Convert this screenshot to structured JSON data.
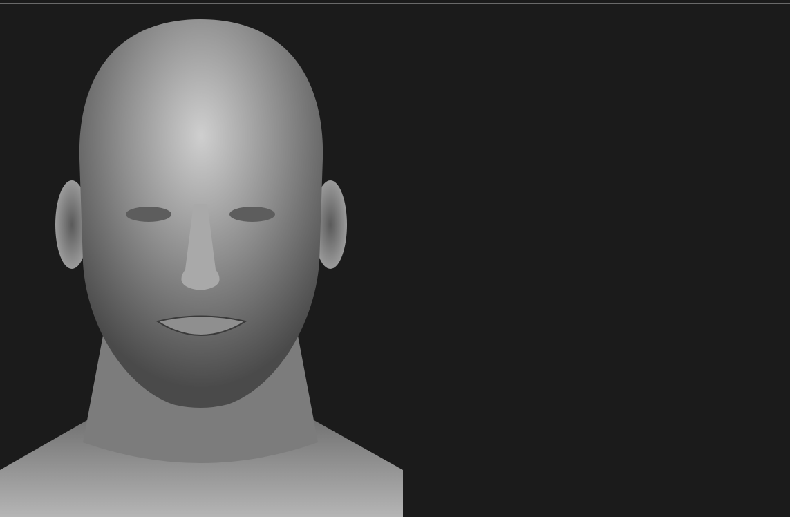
{
  "colors": {
    "background": "#1b1b1b",
    "frame_line": "#6a6a6a",
    "clay_light": "#c8c8c8",
    "clay_mid": "#8a8a8a",
    "clay_dark": "#3a3a3a"
  }
}
